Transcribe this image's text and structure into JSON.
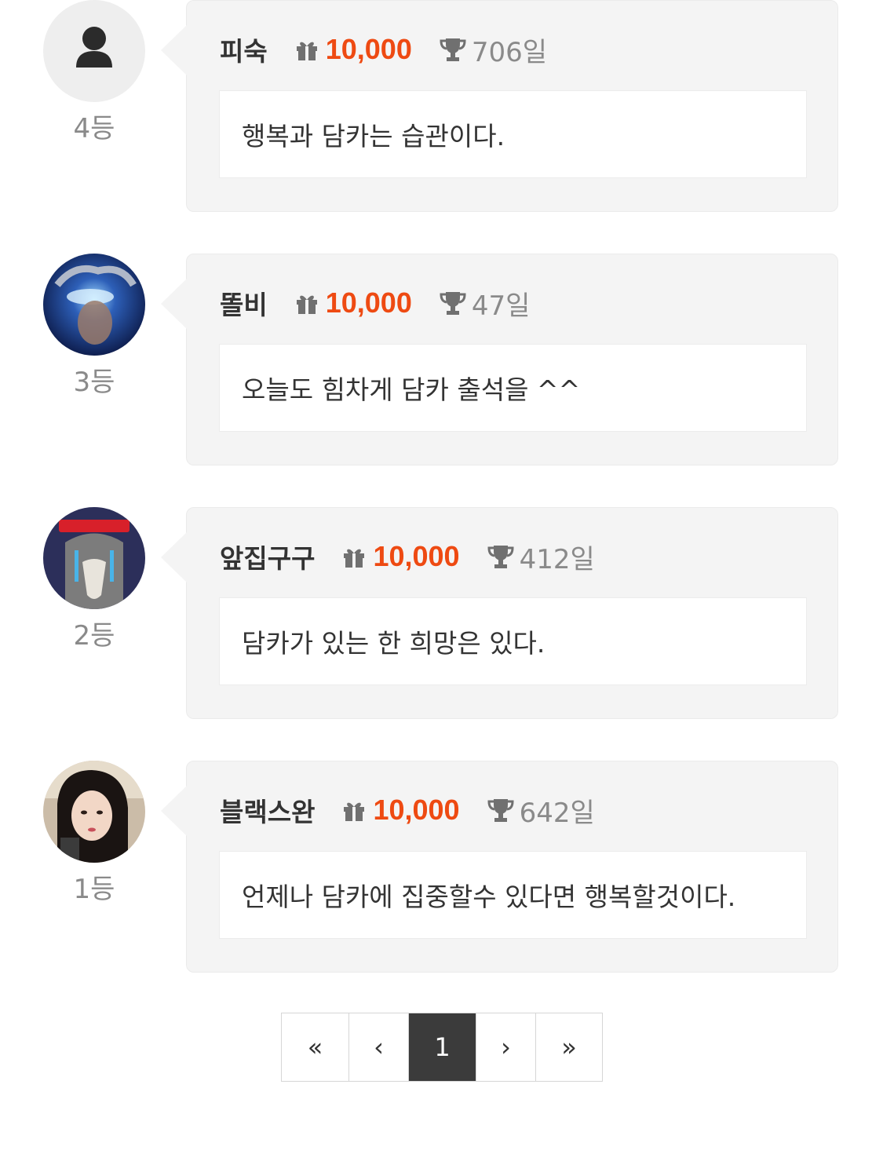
{
  "entries": [
    {
      "rank": "4등",
      "username": "피숙",
      "points": "10,000",
      "days": "706일",
      "message": "행복과 담카는 습관이다.",
      "avatar": "default-person-icon"
    },
    {
      "rank": "3등",
      "username": "똘비",
      "points": "10,000",
      "days": "47일",
      "message": "오늘도 힘차게 담카 출석을 ^^",
      "avatar": "photo-avatar"
    },
    {
      "rank": "2등",
      "username": "앞집구구",
      "points": "10,000",
      "days": "412일",
      "message": "담카가 있는 한 희망은 있다.",
      "avatar": "photo-avatar"
    },
    {
      "rank": "1등",
      "username": "블랙스완",
      "points": "10,000",
      "days": "642일",
      "message": "언제나 담카에 집중할수 있다면 행복할것이다.",
      "avatar": "photo-avatar"
    }
  ],
  "pagination": {
    "first": "«",
    "prev": "‹",
    "current": "1",
    "next": "›",
    "last": "»"
  },
  "icons": {
    "points": "gift-icon",
    "days": "trophy-icon"
  },
  "colors": {
    "points": "#ee4a12",
    "active_page": "#3b3b3b"
  }
}
